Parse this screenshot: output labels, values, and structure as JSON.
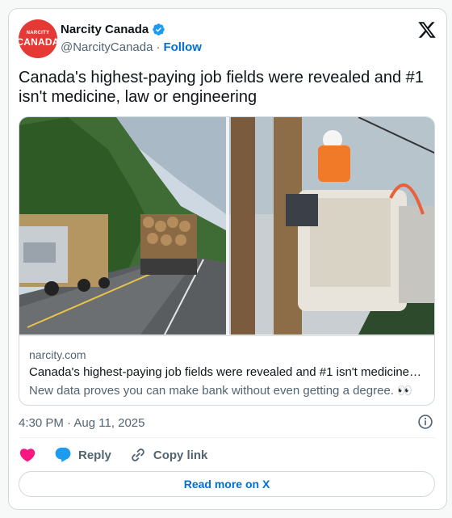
{
  "author": {
    "name": "Narcity Canada",
    "handle": "@NarcityCanada",
    "separator": "·",
    "follow_label": "Follow",
    "avatar_line1": "NARCITY",
    "avatar_line2": "CANADA",
    "avatar_color": "#e53935"
  },
  "tweet": {
    "text": "Canada's highest-paying job fields were revealed and #1 isn't medicine, law or engineering",
    "timestamp": "4:30 PM · Aug 11, 2025"
  },
  "link_card": {
    "domain": "narcity.com",
    "title": "Canada's highest-paying job fields were revealed and #1 isn't medicine…",
    "description": "New data proves you can make bank without even getting a degree. 👀"
  },
  "actions": {
    "like_icon": "heart-icon",
    "reply_label": "Reply",
    "copy_label": "Copy link"
  },
  "read_more_label": "Read more on X",
  "colors": {
    "accent": "#006fd6",
    "like": "#f91880",
    "reply": "#1d9bf0",
    "verified": "#1d9bf0",
    "secondary_text": "#536471"
  }
}
